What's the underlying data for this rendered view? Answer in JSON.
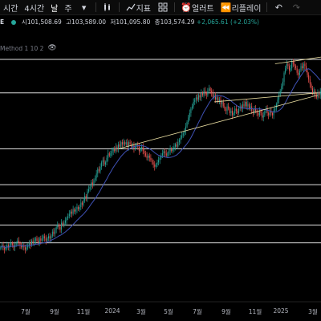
{
  "toolbar": {
    "items": [
      "시간",
      "4시간",
      "날",
      "주"
    ],
    "indicators_label": "지표",
    "alert_label": "얼러트",
    "replay_label": "리플레이"
  },
  "legend": {
    "symbol": "E",
    "open_key": "시",
    "open": "101,508.69",
    "high_key": "고",
    "high": "103,589.00",
    "low_key": "저",
    "low": "101,095.80",
    "close_key": "종",
    "close": "103,574.29",
    "change": "+2,065.61 (+2.03%)"
  },
  "indicator_label": "Method 1 10 2",
  "colors": {
    "background": "#000000",
    "candle_up": "#26a69a",
    "candle_down": "#ef5350",
    "ma_line": "#3f51b5",
    "levels": "#e0e0e0",
    "trendline": "#e8dca0",
    "change_positive": "#26a69a"
  },
  "x_axis_labels": [
    "7월",
    "9월",
    "11월",
    "2024",
    "3월",
    "5월",
    "7월",
    "9월",
    "11월",
    "2025",
    "3월"
  ],
  "chart_data": {
    "type": "candlestick",
    "x_labels": [
      "7월",
      "9월",
      "11월",
      "2024",
      "3월",
      "5월",
      "7월",
      "9월",
      "11월",
      "2025",
      "3월"
    ],
    "closes": [
      26,
      27,
      26,
      25,
      26,
      27,
      26,
      27,
      28,
      27,
      26,
      27,
      28,
      29,
      28,
      27,
      26,
      27,
      26,
      25,
      26,
      27,
      28,
      27,
      29,
      28,
      29,
      30,
      29,
      28,
      30,
      29,
      30,
      31,
      30,
      29,
      30,
      31,
      30,
      31,
      33,
      32,
      34,
      35,
      36,
      35,
      34,
      37,
      36,
      37,
      38,
      39,
      40,
      41,
      42,
      41,
      43,
      42,
      43,
      44,
      43,
      44,
      46,
      45,
      47,
      49,
      48,
      51,
      52,
      53,
      55,
      54,
      56,
      57,
      59,
      61,
      60,
      62,
      64,
      65,
      63,
      64,
      66,
      68,
      67,
      68,
      69,
      70,
      69,
      71,
      70,
      72,
      71,
      73,
      72,
      73,
      72,
      73,
      71,
      73,
      72,
      71,
      72,
      70,
      71,
      72,
      71,
      69,
      70,
      71,
      69,
      68,
      67,
      66,
      67,
      66,
      65,
      64,
      63,
      62,
      63,
      64,
      65,
      66,
      67,
      68,
      69,
      68,
      67,
      68,
      69,
      70,
      69,
      70,
      71,
      72,
      71,
      73,
      74,
      75,
      76,
      77,
      78,
      80,
      82,
      84,
      86,
      88,
      89,
      91,
      92,
      93,
      92,
      94,
      93,
      95,
      94,
      96,
      95,
      94,
      96,
      97,
      96,
      95,
      93,
      94,
      92,
      93,
      91,
      92,
      90,
      91,
      89,
      88,
      87,
      89,
      88,
      86,
      87,
      85,
      86,
      88,
      87,
      86,
      88,
      89,
      88,
      90,
      89,
      91,
      89,
      90,
      88,
      89,
      87,
      86,
      88,
      87,
      86,
      85,
      87,
      86,
      84,
      85,
      87,
      88,
      86,
      85,
      87,
      86,
      85,
      87,
      88,
      90,
      92,
      94,
      96,
      98,
      100,
      104,
      106,
      108,
      107,
      105,
      106,
      109,
      108,
      107,
      106,
      104,
      103,
      105,
      107,
      106,
      108,
      107,
      105,
      103,
      101,
      99,
      97,
      95,
      96,
      94,
      93,
      95,
      94,
      96
    ],
    "levels": [
      110,
      95,
      70,
      54,
      48,
      36,
      28
    ]
  }
}
